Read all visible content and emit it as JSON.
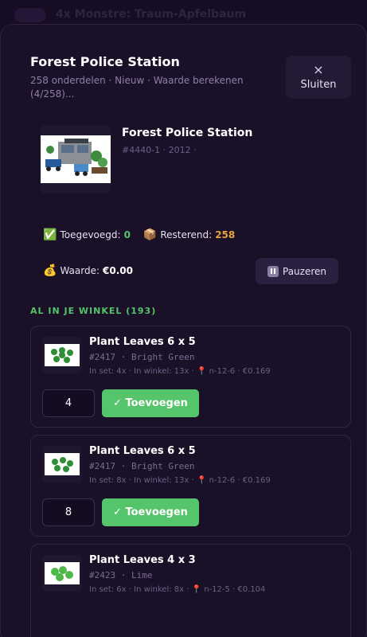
{
  "background": {
    "title": "4x Monstre: Traum-Apfelbaum"
  },
  "modal": {
    "title": "Forest Police Station",
    "subtitle": "258 onderdelen · Nieuw · Waarde berekenen (4/258)...",
    "close_icon": "×",
    "close_label": "Sluiten"
  },
  "set": {
    "name": "Forest Police Station",
    "meta": "#4440-1 · 2012 ·"
  },
  "stats": {
    "added_emoji": "✅",
    "added_label": "Toegevoegd:",
    "added_value": "0",
    "remaining_emoji": "📦",
    "remaining_label": "Resterend:",
    "remaining_value": "258",
    "value_emoji": "💰",
    "value_label": "Waarde:",
    "value_amount": "€0.00",
    "pause_label": "Pauzeren"
  },
  "section": {
    "label": "AL IN JE WINKEL (193)"
  },
  "items": [
    {
      "name": "Plant Leaves 6 x 5",
      "code": "#2417 · Bright Green",
      "meta": "In set: 4x · In winkel: 13x · 📍 n-12-6 · €0.169",
      "qty": "4",
      "add_label": "✓ Toevoegen"
    },
    {
      "name": "Plant Leaves 6 x 5",
      "code": "#2417 · Bright Green",
      "meta": "In set: 8x · In winkel: 13x · 📍 n-12-6 · €0.169",
      "qty": "8",
      "add_label": "✓ Toevoegen"
    },
    {
      "name": "Plant Leaves 4 x 3",
      "code": "#2423 · Lime",
      "meta": "In set: 6x · In winkel: 8x · 📍 n-12-5 · €0.104"
    }
  ],
  "icons": {
    "close": "close-icon",
    "pause": "pause-icon",
    "added": "check-box-icon",
    "remaining": "package-icon",
    "value": "money-bag-icon"
  },
  "colors": {
    "accent_green": "#55c46b",
    "accent_orange": "#e8a23c",
    "background": "#1a1128"
  }
}
